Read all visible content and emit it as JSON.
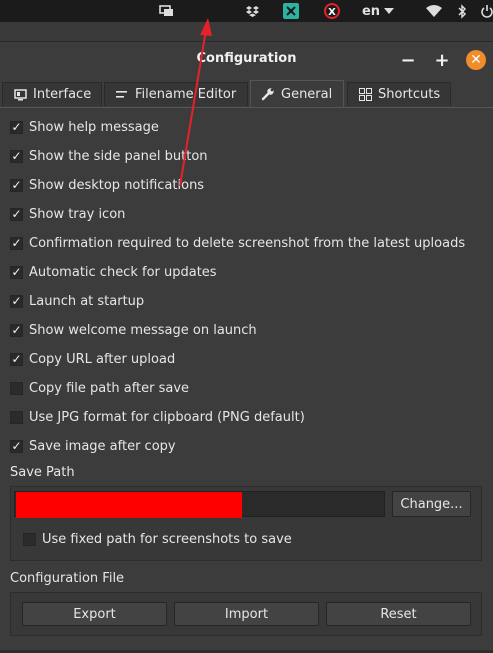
{
  "top_panel": {
    "icons": [
      "display-icon",
      "dropbox-icon",
      "app-indicator-icon",
      "xfce-screenshooter-icon",
      "wifi-icon",
      "bluetooth-icon",
      "power-icon"
    ],
    "language": "en"
  },
  "window": {
    "title": "Configuration",
    "minimize_label": "−",
    "maximize_label": "+",
    "close_label": "✕"
  },
  "tabs": [
    {
      "label": "Interface",
      "icon": "monitor-icon",
      "active": false
    },
    {
      "label": "Filename Editor",
      "icon": "text-lines-icon",
      "active": false
    },
    {
      "label": "General",
      "icon": "wrench-icon",
      "active": true
    },
    {
      "label": "Shortcuts",
      "icon": "grid-icon",
      "active": false
    }
  ],
  "options": [
    {
      "label": "Show help message",
      "checked": true
    },
    {
      "label": "Show the side panel button",
      "checked": true
    },
    {
      "label": "Show desktop notifications",
      "checked": true
    },
    {
      "label": "Show tray icon",
      "checked": true
    },
    {
      "label": "Confirmation required to delete screenshot from the latest uploads",
      "checked": true
    },
    {
      "label": "Automatic check for updates",
      "checked": true
    },
    {
      "label": "Launch at startup",
      "checked": true
    },
    {
      "label": "Show welcome message on launch",
      "checked": true
    },
    {
      "label": "Copy URL after upload",
      "checked": true
    },
    {
      "label": "Copy file path after save",
      "checked": false
    },
    {
      "label": "Use JPG format for clipboard (PNG default)",
      "checked": false
    },
    {
      "label": "Save image after copy",
      "checked": true
    }
  ],
  "save_path": {
    "section_label": "Save Path",
    "value": "",
    "change_label": "Change...",
    "fixed_path_label": "Use fixed path for screenshots to save",
    "fixed_path_checked": false
  },
  "config_file": {
    "section_label": "Configuration File",
    "export_label": "Export",
    "import_label": "Import",
    "reset_label": "Reset"
  },
  "colors": {
    "background": "#3c3c3c",
    "panel": "#1b1b1b",
    "close_button": "#f08c2c",
    "annotation_arrow": "#e8202a",
    "redaction": "#ff0000"
  }
}
